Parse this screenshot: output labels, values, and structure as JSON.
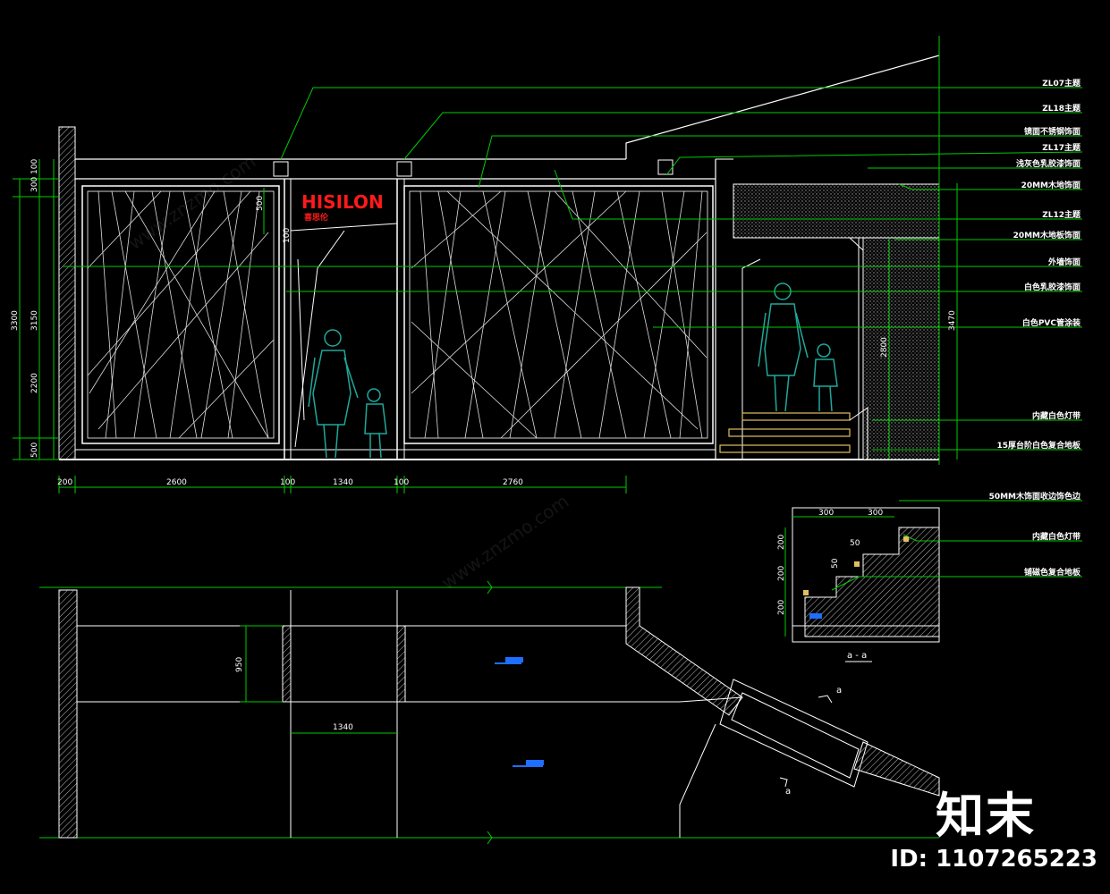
{
  "title": "",
  "signage": {
    "logo_text": "HISILON",
    "logo_sub": "喜思伦"
  },
  "notes": [
    "ZL07主题",
    "ZL18主题",
    "镜面不锈钢饰面",
    "ZL17主题",
    "浅灰色乳胶漆饰面",
    "20MM木地饰面",
    "ZL12主题",
    "20MM木地板饰面",
    "外墙饰面",
    "白色乳胶漆饰面",
    "白色PVC管涂装",
    "内藏白色灯带",
    "15厚台阶白色复合地板"
  ],
  "section_notes": [
    "50MM木饰面收边饰色边",
    "内藏白色灯带",
    "铺磁色复合地板"
  ],
  "dims": {
    "horiz": [
      "200",
      "2600",
      "100",
      "1340",
      "100",
      "2760"
    ],
    "vert": [
      "500",
      "2200",
      "300",
      "3300",
      "3150",
      "500",
      "100",
      "100"
    ],
    "plan_950": "950",
    "plan_1340": "1340",
    "right_3470": "3470",
    "right_2800": "2800",
    "section_300a": "300",
    "section_300b": "300",
    "section_200a": "200",
    "section_200b": "200",
    "section_200c": "200",
    "section_50a": "50",
    "section_50b": "50"
  },
  "section_title": "a - a",
  "section_marks": [
    "a",
    "a"
  ],
  "watermark": {
    "brand": "知末",
    "id": "ID: 1107265223",
    "url": "www.znzmo.com"
  },
  "colors": {
    "bg": "#000000",
    "line": "#ffffff",
    "dim_green": "#00cc00",
    "people": "#1fa89a",
    "logo_red": "#ff1a1a",
    "stair_yellow": "#e0c060",
    "blue_mark": "#1e6fff"
  }
}
